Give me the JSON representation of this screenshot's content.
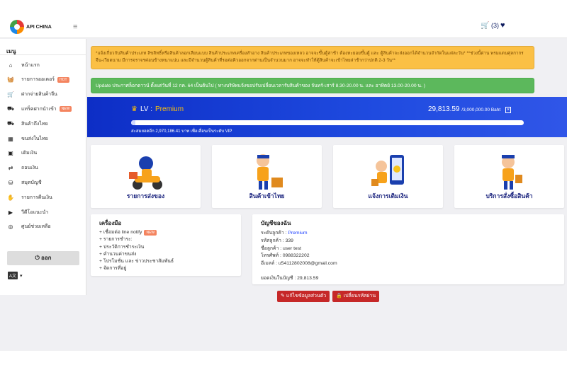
{
  "header": {
    "logo_text": "API CHINA",
    "cart_count": "(3)"
  },
  "sidebar": {
    "title": "เมนู",
    "items": [
      {
        "label": "หน้าแรก",
        "icon": "home-icon",
        "glyph": "⌂",
        "badge": ""
      },
      {
        "label": "รายการออเดอร์",
        "icon": "basket-icon",
        "glyph": "🧺",
        "badge": "HOT"
      },
      {
        "label": "ฝากจ่ายสินค้าจีน",
        "icon": "cart-icon",
        "glyph": "🛒",
        "badge": ""
      },
      {
        "label": "แทร็คฝากนำเข้า",
        "icon": "truck-icon",
        "glyph": "⛟",
        "badge": "NEW"
      },
      {
        "label": "สินค้าถึงไทย",
        "icon": "delivery-truck-icon",
        "glyph": "⛟",
        "badge": ""
      },
      {
        "label": "ขนส่งในไทย",
        "icon": "shipping-box-icon",
        "glyph": "▦",
        "badge": ""
      },
      {
        "label": "เติมเงิน",
        "icon": "money-icon",
        "glyph": "▣",
        "badge": ""
      },
      {
        "label": "ถอนเงิน",
        "icon": "exchange-icon",
        "glyph": "⇄",
        "badge": ""
      },
      {
        "label": "สมุดบัญชี",
        "icon": "bank-icon",
        "glyph": "⛁",
        "badge": ""
      },
      {
        "label": "รายการคืนเงิน",
        "icon": "refund-hand-icon",
        "glyph": "✋",
        "badge": ""
      },
      {
        "label": "วีดีโอแนะนำ",
        "icon": "video-icon",
        "glyph": "▶",
        "badge": ""
      },
      {
        "label": "ศูนย์ช่วยเหลือ",
        "icon": "help-icon",
        "glyph": "◎",
        "badge": ""
      }
    ],
    "logout_label": "ออก",
    "lang_badge": "A文"
  },
  "alerts": {
    "warning": "*แจ้งเกี่ยวกับสินค้าประเภท ลิขสิทธิ์หรือสินค้าลอกเลียนแบบ สินค้าประเภทเครื่องสำอาง สินค้าประเภทของเหลว อาจจะขึ้นตู้ล่าช้า ต้องทะยอยขึ้นตู้ และ ตู้สินค้าจะส่งออกได้จำนวนจำกัดในแต่ละวัน* **ช่วงนี้ด่าน พรมแดนศุลกากร จีน-เวียดนาม มีการจราจรค่อนข้างหนาแน่น และมีจำนวนตู้สินค้าที่รอต่อคิวออกจากด่านเป็นจำนวนมาก อาจจะทำให้ตู้สินค้าจะเข้าไทยล่าช้ากว่าปกติ 2-3 วัน**",
    "update": "Update ประกาศล็อกดาวน์ ตั้งแต่วันที่ 12 กค. 64 เป็นต้นไป ( ทางบริษัทแจ้งขอปรับเปลี่ยนเวลารับสินค้าของ จันทร์-เสาร์ 8.30-20.00 น. และ อาทิตย์ 13.00-20.00 น. )"
  },
  "level": {
    "label": "LV : ",
    "name": "Premium",
    "amount": "29,813.59",
    "limit": "/3,000,000.00 Baht",
    "progress": 0.01,
    "note": "สะสมยอดอีก 2,970,186.41 บาท เพื่อเลื่อนเป็นระดับ VIP"
  },
  "cards": [
    {
      "label": "รายการส่งของ",
      "icon": "delivery-scooter-icon"
    },
    {
      "label": "สินค้าเข้าไทย",
      "icon": "courier-boxes-icon"
    },
    {
      "label": "แจ้งการเติมเงิน",
      "icon": "phone-payment-icon"
    },
    {
      "label": "บริการสั่งซื้อสินค้า",
      "icon": "shopping-service-icon"
    }
  ],
  "tools": {
    "title": "เครื่องมือ",
    "items": [
      {
        "label": "+ เชื่อมต่อ line notify",
        "badge": "NEW"
      },
      {
        "label": "+ รายการชำระ:",
        "badge": ""
      },
      {
        "label": "+ ประวัติการชำระเงิน",
        "badge": ""
      },
      {
        "label": "+ คำนวนค่าขนส่ง",
        "badge": ""
      },
      {
        "label": "+ โปรโมชั่น และ ข่าวประชาสัมพันธ์",
        "badge": ""
      },
      {
        "label": "+ จัดการที่อยู่",
        "badge": ""
      }
    ]
  },
  "account": {
    "title": "บัญชีของฉัน",
    "level_label": "ระดับลูกค้า : ",
    "level_value": "Premium",
    "code": "รหัสลูกค้า : 339",
    "name": "ชื่อลูกค้า : user test",
    "phone": "โทรศัพท์ : 0988322202",
    "email": "อีเมลล์ : u54112802008@gmail.com",
    "balance": "ยอดเงินในบัญชี : 29,813.59"
  },
  "buttons": {
    "edit_profile": "แก้ไขข้อมูลส่วนตัว",
    "change_password": "เปลี่ยนรหัสผ่าน"
  },
  "colors": {
    "brand_blue": "#1f4be0",
    "premium": "#ffc107",
    "warning_bg": "#fbc045",
    "success_bg": "#5cb85c",
    "button_red": "#c62828"
  }
}
